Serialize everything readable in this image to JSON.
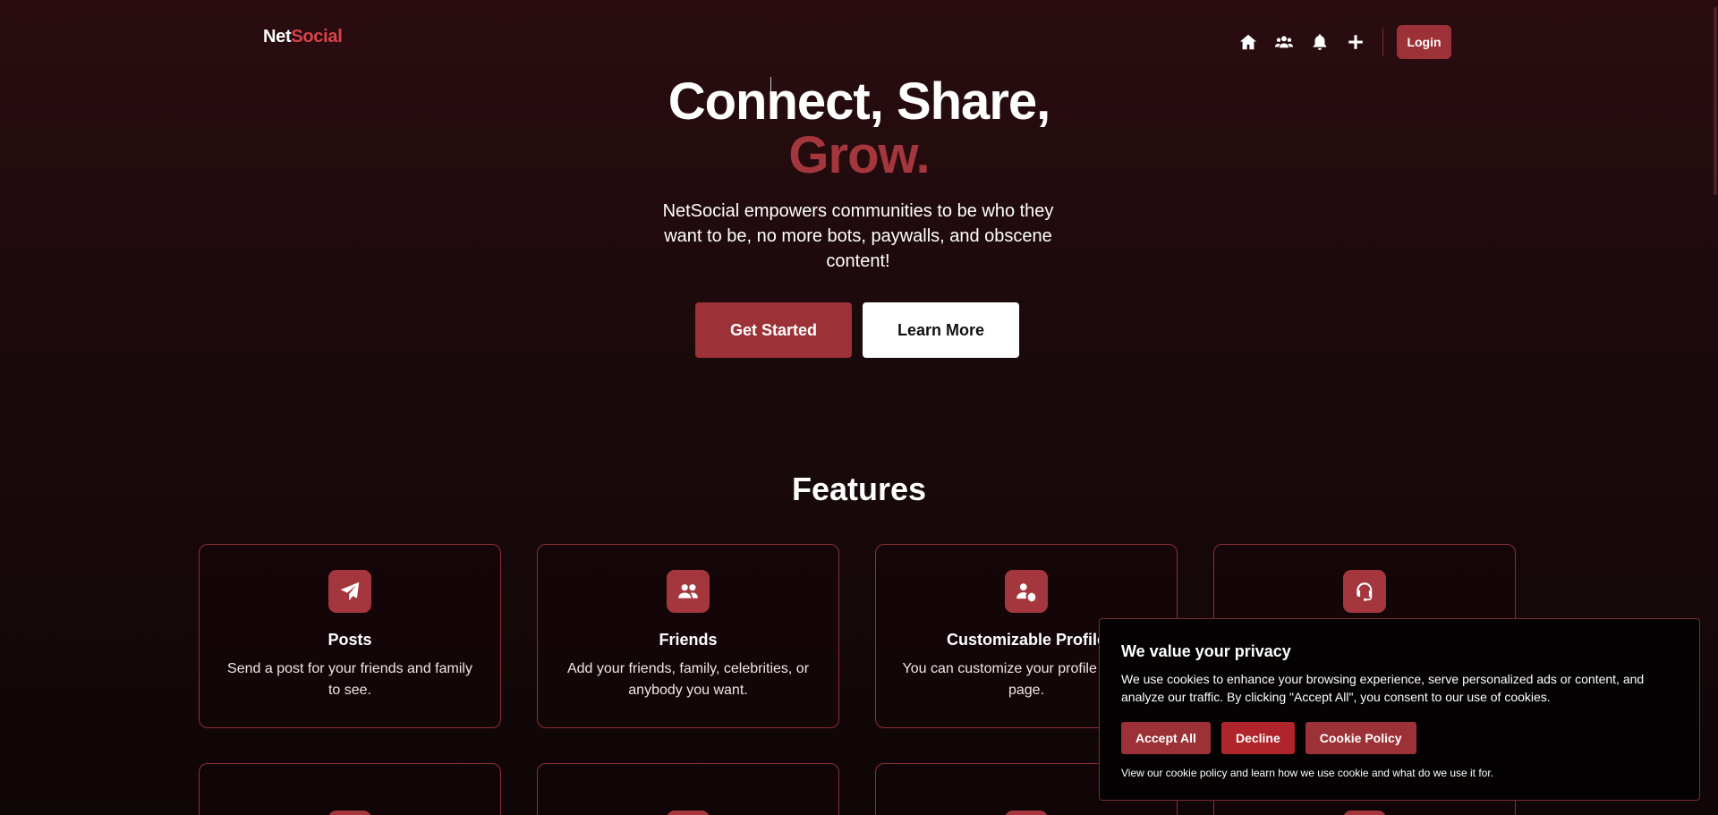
{
  "nav": {
    "logo_part1": "Net",
    "logo_part2": "Social",
    "icons": [
      "home-icon",
      "users-icon",
      "bell-icon",
      "plus-icon"
    ],
    "login_label": "Login"
  },
  "hero": {
    "title_line1": "Connect, Share,",
    "title_line2": "Grow.",
    "subtitle": "NetSocial empowers communities to be who they want to be, no more bots, paywalls, and obscene content!",
    "primary_button": "Get Started",
    "secondary_button": "Learn More"
  },
  "features": {
    "title": "Features",
    "cards": [
      {
        "icon": "paper-plane-icon",
        "title": "Posts",
        "desc": "Send a post for your friends and family to see."
      },
      {
        "icon": "users-icon",
        "title": "Friends",
        "desc": "Add your friends, family, celebrities, or anybody you want."
      },
      {
        "icon": "user-gear-icon",
        "title": "Customizable Profile",
        "desc": "You can customize your profile settings page."
      },
      {
        "icon": "headset-icon",
        "title": "",
        "desc": ""
      }
    ],
    "row2_icons": [
      "feature-icon",
      "feature-icon",
      "feature-icon",
      "github-icon"
    ]
  },
  "cookie": {
    "title": "We value your privacy",
    "text": "We use cookies to enhance your browsing experience, serve personalized ads or content, and analyze our traffic. By clicking \"Accept All\", you consent to our use of cookies.",
    "accept": "Accept All",
    "decline": "Decline",
    "policy": "Cookie Policy",
    "note": "View our cookie policy and learn how we use cookie and what do we use it for."
  },
  "colors": {
    "accent": "#a3373d",
    "bg_top": "#2a0c10",
    "bg_bottom": "#0f0607"
  }
}
